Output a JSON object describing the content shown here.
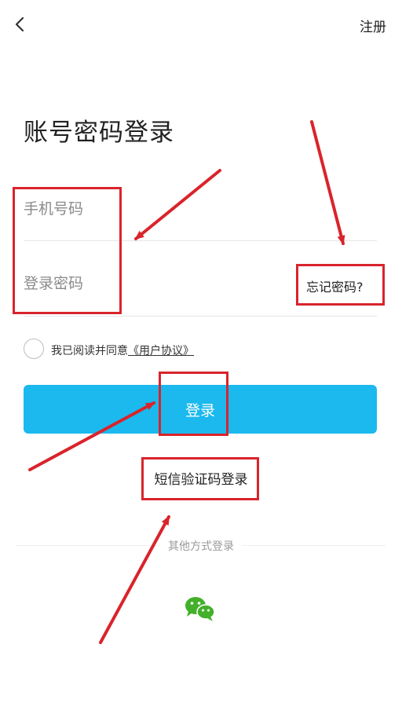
{
  "header": {
    "back_icon": "chevron-left-icon",
    "register_label": "注册"
  },
  "title": "账号密码登录",
  "form": {
    "phone_placeholder": "手机号码",
    "password_placeholder": "登录密码",
    "forgot_label": "忘记密码?"
  },
  "agreement": {
    "checked": false,
    "prefix": "我已阅读并同意",
    "link_text": "《用户协议》"
  },
  "login_label": "登录",
  "sms_login_label": "短信验证码登录",
  "other_methods": {
    "label": "其他方式登录",
    "wechat_icon": "wechat-icon"
  },
  "colors": {
    "primary": "#1bb9ee",
    "annotation": "#d9242b",
    "wechat": "#43b02a"
  }
}
